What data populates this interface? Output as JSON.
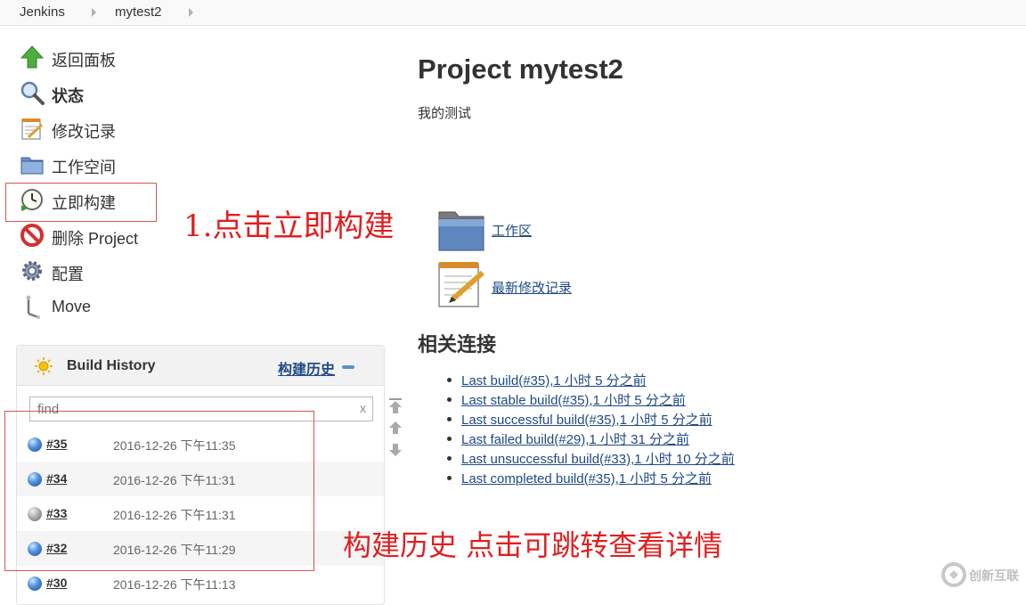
{
  "breadcrumb": [
    "Jenkins",
    "mytest2"
  ],
  "tasks": [
    {
      "label": "返回面板",
      "icon": "up-arrow-icon"
    },
    {
      "label": "状态",
      "icon": "search-icon"
    },
    {
      "label": "修改记录",
      "icon": "notepad-icon"
    },
    {
      "label": "工作空间",
      "icon": "folder-icon"
    },
    {
      "label": "立即构建",
      "icon": "clock-icon"
    },
    {
      "label": "删除 Project",
      "icon": "no-entry-icon"
    },
    {
      "label": "配置",
      "icon": "gear-icon"
    },
    {
      "label": "Move",
      "icon": "move-icon"
    }
  ],
  "annotations": {
    "build_now": "1.点击立即构建",
    "history": "构建历史 点击可跳转查看详情"
  },
  "build_history": {
    "title": "Build History",
    "trend_link": "构建历史",
    "find_placeholder": "find",
    "clear": "x",
    "builds": [
      {
        "number": "#35",
        "date": "2016-12-26 下午11:35",
        "status": "blue"
      },
      {
        "number": "#34",
        "date": "2016-12-26 下午11:31",
        "status": "blue"
      },
      {
        "number": "#33",
        "date": "2016-12-26 下午11:31",
        "status": "grey"
      },
      {
        "number": "#32",
        "date": "2016-12-26 下午11:29",
        "status": "blue"
      },
      {
        "number": "#30",
        "date": "2016-12-26 下午11:13",
        "status": "blue"
      }
    ]
  },
  "main": {
    "title": "Project mytest2",
    "description": "我的测试",
    "workspace_link": "工作区",
    "changes_link": "最新修改记录",
    "permalinks_title": "相关连接",
    "permalinks": [
      "Last build(#35),1 小时 5 分之前",
      "Last stable build(#35),1 小时 5 分之前",
      "Last successful build(#35),1 小时 5 分之前",
      "Last failed build(#29),1 小时 31 分之前",
      "Last unsuccessful build(#33),1 小时 10 分之前",
      "Last completed build(#35),1 小时 5 分之前"
    ]
  },
  "watermark": "创新互联"
}
